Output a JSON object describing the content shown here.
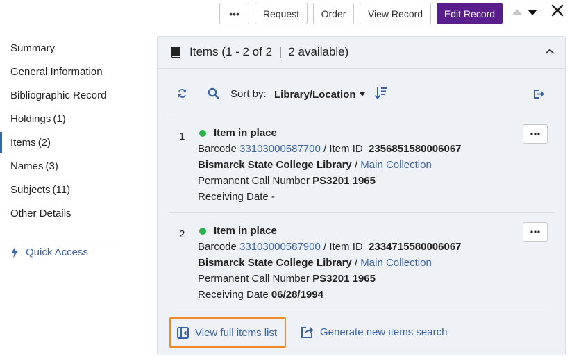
{
  "toolbar": {
    "more_label": "•••",
    "request_label": "Request",
    "order_label": "Order",
    "view_record_label": "View Record",
    "edit_record_label": "Edit Record"
  },
  "sidebar": {
    "items": [
      {
        "label": "Summary",
        "count": ""
      },
      {
        "label": "General Information",
        "count": ""
      },
      {
        "label": "Bibliographic Record",
        "count": ""
      },
      {
        "label": "Holdings",
        "count": "(1)"
      },
      {
        "label": "Items",
        "count": "(2)"
      },
      {
        "label": "Names",
        "count": "(3)"
      },
      {
        "label": "Subjects",
        "count": "(11)"
      },
      {
        "label": "Other Details",
        "count": ""
      }
    ],
    "active_index": 4,
    "quick_access_label": "Quick Access"
  },
  "panel": {
    "title": "Items (1 - 2 of 2  |  2 available)",
    "sort_label": "Sort by:",
    "sort_value": "Library/Location"
  },
  "items": [
    {
      "num": "1",
      "status": "Item in place",
      "barcode_label": "Barcode",
      "barcode": "33103000587700",
      "item_id_label": "/ Item ID",
      "item_id": "2356851580006067",
      "library": "Bismarck State College Library",
      "location_sep": "/",
      "location": "Main Collection",
      "call_label": "Permanent Call Number",
      "call_number": "PS3201 1965",
      "receiving_label": "Receiving Date",
      "receiving_date": "-"
    },
    {
      "num": "2",
      "status": "Item in place",
      "barcode_label": "Barcode",
      "barcode": "33103000587900",
      "item_id_label": "/ Item ID",
      "item_id": "2334715580006067",
      "library": "Bismarck State College Library",
      "location_sep": "/",
      "location": "Main Collection",
      "call_label": "Permanent Call Number",
      "call_number": "PS3201 1965",
      "receiving_label": "Receiving Date",
      "receiving_date": "06/28/1994"
    }
  ],
  "footer": {
    "view_full_label": "View full items list",
    "generate_label": "Generate new items search"
  },
  "colors": {
    "accent_purple": "#5a1e8c",
    "link_blue": "#3a63a6",
    "status_green": "#2cb34a",
    "highlight_orange": "#f08a24"
  }
}
